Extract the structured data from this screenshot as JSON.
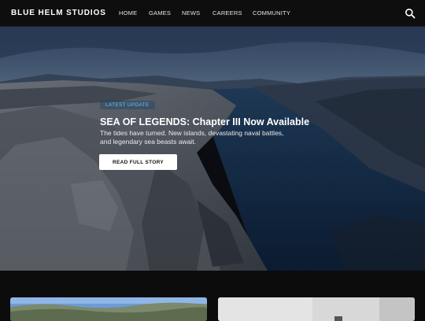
{
  "header": {
    "brand": "BLUE HELM STUDIOS",
    "nav": [
      "HOME",
      "GAMES",
      "NEWS",
      "CAREERS",
      "COMMUNITY"
    ],
    "search_icon": "search-icon"
  },
  "hero": {
    "badge": "LATEST UPDATE",
    "title": "SEA OF LEGENDS: Chapter III Now Available",
    "description": "The tides have turned. New islands, devastating naval battles, and legendary sea beasts await.",
    "cta": "READ FULL STORY"
  },
  "colors": {
    "accent": "#5ec4ff",
    "background": "#0c0c0d",
    "nav_bg": "#0e0e0f"
  }
}
